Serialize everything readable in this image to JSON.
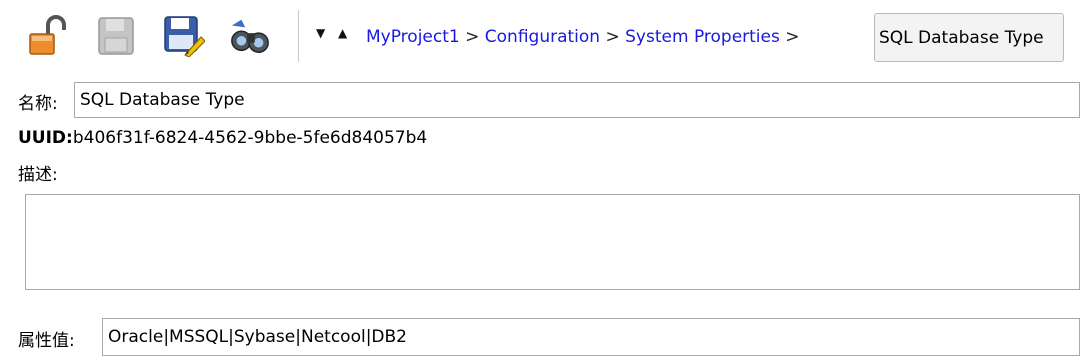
{
  "toolbar": {
    "icons": [
      "unlock-icon",
      "save-disabled-icon",
      "save-as-icon",
      "binoculars-icon"
    ],
    "collapse_arrow": "▼",
    "expand_arrow": "▲"
  },
  "breadcrumb": {
    "items": [
      "MyProject1",
      "Configuration",
      "System Properties"
    ],
    "separator": ">",
    "current": "SQL Database Type"
  },
  "form": {
    "name_label": "名称:",
    "name_value": "SQL Database Type",
    "uuid_label": "UUID:",
    "uuid_value": "b406f31f-6824-4562-9bbe-5fe6d84057b4",
    "description_label": "描述:",
    "description_value": "",
    "property_value_label": "属性值:",
    "property_value": "Oracle|MSSQL|Sybase|Netcool|DB2"
  },
  "colors": {
    "link": "#1a1adc",
    "lock_orange": "#e8882a"
  }
}
